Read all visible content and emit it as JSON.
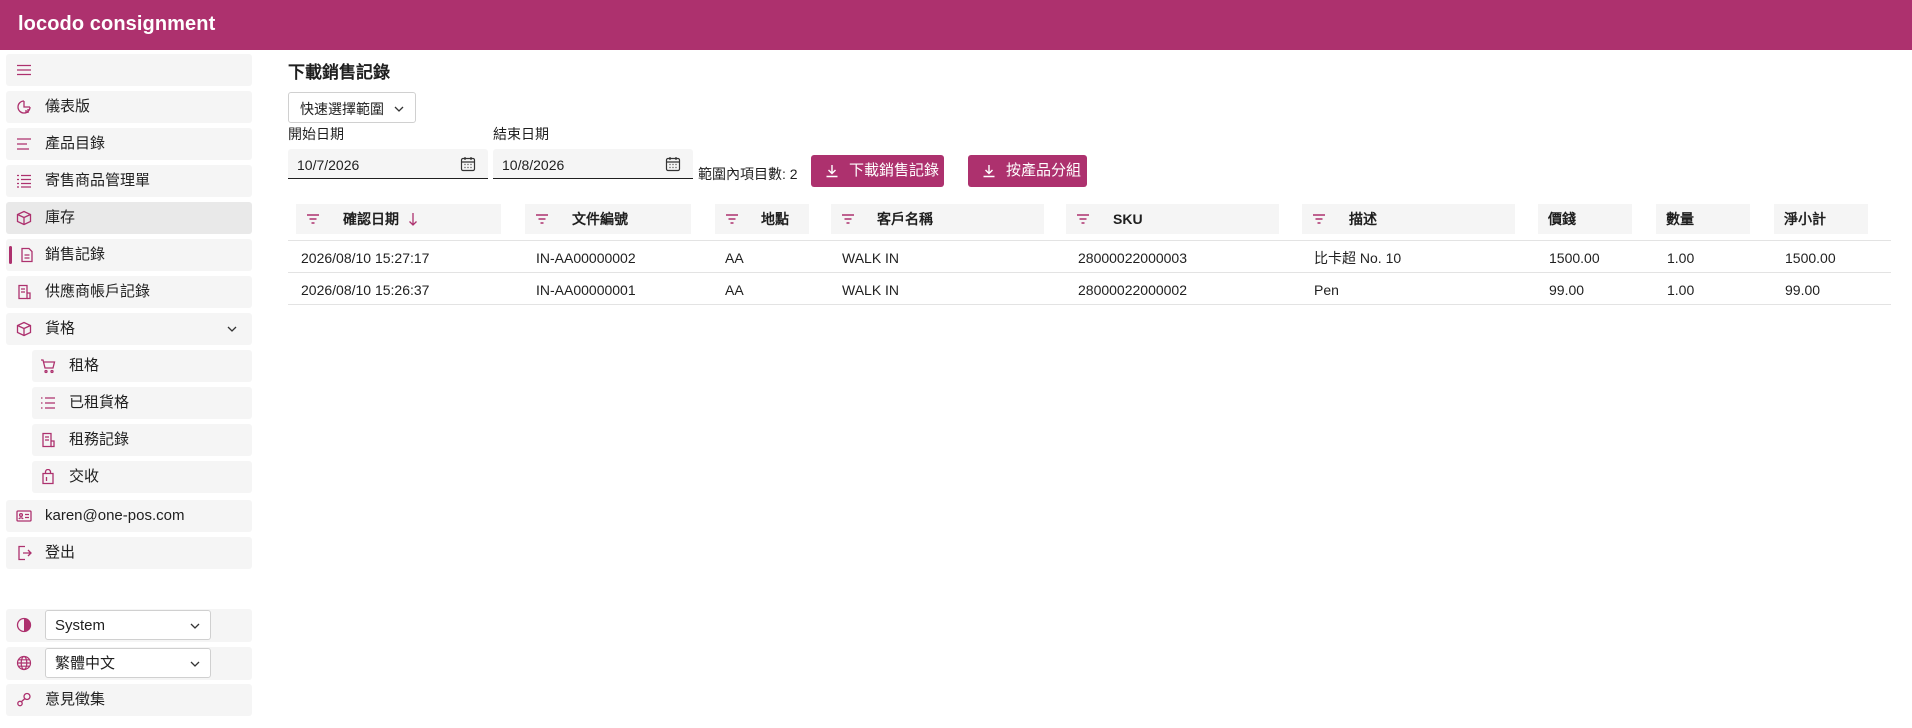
{
  "app": {
    "title": "locodo consignment"
  },
  "sidebar": {
    "items": [
      {
        "label": "儀表版",
        "icon": "dashboard-icon"
      },
      {
        "label": "產品目錄",
        "icon": "catalog-icon"
      },
      {
        "label": "寄售商品管理單",
        "icon": "checklist-icon"
      },
      {
        "label": "庫存",
        "icon": "box-icon"
      },
      {
        "label": "銷售記錄",
        "icon": "document-icon"
      },
      {
        "label": "供應商帳戶記錄",
        "icon": "receipt-icon"
      },
      {
        "label": "貨格",
        "icon": "box-icon"
      }
    ],
    "subitems": [
      {
        "label": "租格",
        "icon": "cart-icon"
      },
      {
        "label": "已租貨格",
        "icon": "list-icon"
      },
      {
        "label": "租務記錄",
        "icon": "receipt-icon"
      },
      {
        "label": "交收",
        "icon": "bag-icon"
      }
    ],
    "user_email": "karen@one-pos.com",
    "logout": "登出",
    "theme_value": "System",
    "language_value": "繁體中文",
    "feedback": "意見徵集"
  },
  "main": {
    "title": "下載銷售記錄",
    "quick_range": "快速選擇範圍",
    "start_label": "開始日期",
    "start_value": "10/7/2026",
    "end_label": "結束日期",
    "end_value": "10/8/2026",
    "count_text": "範圍內項目數: 2",
    "download_button": "下載銷售記錄",
    "group_button": "按產品分組"
  },
  "table": {
    "columns": [
      "確認日期",
      "文件編號",
      "地點",
      "客戶名稱",
      "SKU",
      "描述",
      "價錢",
      "數量",
      "淨小計"
    ],
    "rows": [
      [
        "2026/08/10 15:27:17",
        "IN-AA00000002",
        "AA",
        "WALK IN",
        "28000022000003",
        "比卡超 No. 10",
        "1500.00",
        "1.00",
        "1500.00"
      ],
      [
        "2026/08/10 15:26:37",
        "IN-AA00000001",
        "AA",
        "WALK IN",
        "28000022000002",
        "Pen",
        "99.00",
        "1.00",
        "99.00"
      ]
    ]
  },
  "colors": {
    "brand": "#ad316e",
    "sidebar_bg": "#f5f5f5"
  }
}
